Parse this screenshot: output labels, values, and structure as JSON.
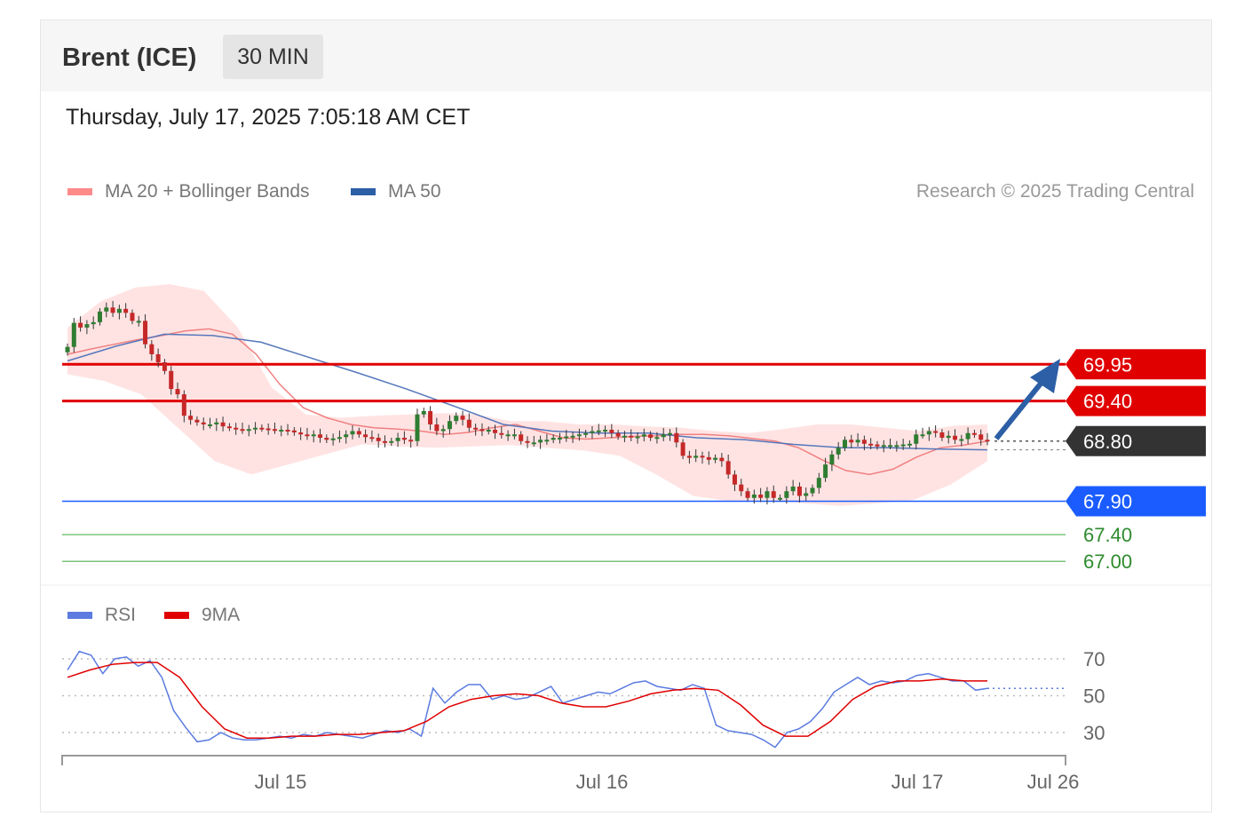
{
  "header": {
    "instrument": "Brent (ICE)",
    "timeframe": "30 MIN",
    "timestamp": "Thursday, July 17, 2025 7:05:18 AM CET"
  },
  "legend": {
    "ma20_label": "MA 20 + Bollinger Bands",
    "ma50_label": "MA 50",
    "credit": "Research © 2025 Trading Central",
    "rsi_label": "RSI",
    "rsi_ma_label": "9MA"
  },
  "colors": {
    "bull_candle": "#2e7d32",
    "bear_candle": "#c62828",
    "bollinger_fill": "#ffdede",
    "ma20": "#f08080",
    "ma50": "#5577bb",
    "resistance": "#e00000",
    "support_primary": "#1a5cff",
    "support_secondary": "#7bc47b",
    "current_price": "#333333",
    "rsi": "#5b7be0",
    "rsi_ma": "#e00000",
    "arrow": "#2c5fa5"
  },
  "chart_data": [
    {
      "type": "candlestick",
      "title": "Brent (ICE) 30 MIN",
      "ylim": [
        66.9,
        71.1
      ],
      "x_ticks": [
        "Jul 15",
        "Jul 16",
        "Jul 17",
        "Jul 26"
      ],
      "current_price": "68.80",
      "projection": "upward toward 69.95",
      "levels": [
        {
          "value": "69.95",
          "type": "resistance"
        },
        {
          "value": "69.40",
          "type": "resistance"
        },
        {
          "value": "68.80",
          "type": "current"
        },
        {
          "value": "67.90",
          "type": "support"
        },
        {
          "value": "67.40",
          "type": "support"
        },
        {
          "value": "67.00",
          "type": "support"
        }
      ],
      "close_series": [
        70.21,
        70.57,
        70.5,
        70.55,
        70.58,
        70.74,
        70.8,
        70.72,
        70.78,
        70.72,
        70.6,
        70.6,
        70.25,
        70.1,
        69.98,
        69.85,
        69.58,
        69.5,
        69.18,
        69.12,
        69.08,
        69.05,
        69.05,
        69.08,
        69.02,
        69.0,
        68.98,
        68.97,
        68.98,
        69.0,
        68.99,
        68.98,
        68.97,
        68.97,
        68.96,
        68.93,
        68.9,
        68.88,
        68.9,
        68.85,
        68.82,
        68.84,
        68.86,
        68.9,
        68.95,
        68.9,
        68.86,
        68.85,
        68.8,
        68.78,
        68.8,
        68.85,
        68.82,
        68.8,
        69.2,
        69.25,
        69.05,
        68.95,
        68.98,
        69.1,
        69.18,
        69.12,
        69.0,
        68.98,
        68.95,
        68.97,
        68.92,
        68.9,
        68.9,
        68.9,
        68.8,
        68.78,
        68.78,
        68.82,
        68.82,
        68.85,
        68.85,
        68.87,
        68.88,
        68.9,
        68.92,
        68.95,
        68.96,
        68.97,
        68.92,
        68.87,
        68.88,
        68.86,
        68.87,
        68.9,
        68.85,
        68.86,
        68.9,
        68.92,
        68.78,
        68.58,
        68.55,
        68.58,
        68.56,
        68.52,
        68.55,
        68.5,
        68.3,
        68.15,
        68.05,
        67.95,
        68.0,
        67.95,
        68.05,
        67.95,
        67.95,
        68.05,
        68.12,
        67.98,
        68.02,
        68.1,
        68.25,
        68.45,
        68.6,
        68.7,
        68.82,
        68.78,
        68.82,
        68.76,
        68.75,
        68.72,
        68.74,
        68.74,
        68.74,
        68.75,
        68.76,
        68.9,
        68.9,
        68.95,
        68.93,
        68.85,
        68.88,
        68.82,
        68.83,
        68.92,
        68.9,
        68.82,
        68.8
      ],
      "ma20_series": [
        70.1,
        70.18,
        70.25,
        70.32,
        70.38,
        70.45,
        70.48,
        70.4,
        70.1,
        69.65,
        69.3,
        69.15,
        69.05,
        69.0,
        68.98,
        68.95,
        68.9,
        68.93,
        69.0,
        69.05,
        68.95,
        68.85,
        68.83,
        68.85,
        68.87,
        68.88,
        68.9,
        68.9,
        68.88,
        68.84,
        68.8,
        68.7,
        68.52,
        68.36,
        68.3,
        68.38,
        68.56,
        68.7,
        68.74,
        68.8
      ],
      "ma50_series": [
        70.0,
        70.22,
        70.4,
        70.38,
        70.28,
        70.05,
        69.82,
        69.58,
        69.32,
        69.05,
        68.95,
        68.92,
        68.92,
        68.85,
        68.82,
        68.75,
        68.7,
        68.7,
        68.68,
        68.67
      ],
      "bollinger_upper": [
        70.5,
        70.9,
        71.1,
        71.15,
        71.05,
        70.5,
        69.6,
        69.2,
        69.15,
        69.18,
        69.2,
        69.22,
        69.2,
        69.1,
        69.1,
        69.05,
        69.05,
        69.02,
        69.0,
        68.95,
        68.92,
        68.98,
        69.05,
        69.05,
        69.0,
        68.95,
        69.03,
        69.05
      ],
      "bollinger_lower": [
        69.8,
        69.7,
        69.5,
        69.0,
        68.5,
        68.3,
        68.45,
        68.6,
        68.75,
        68.72,
        68.7,
        68.72,
        68.74,
        68.7,
        68.66,
        68.58,
        68.3,
        67.98,
        67.9,
        67.92,
        67.87,
        67.83,
        67.87,
        67.92,
        68.15,
        68.5
      ]
    },
    {
      "type": "line",
      "title": "RSI",
      "ylim": [
        15,
        85
      ],
      "y_ticks": [
        "70",
        "50",
        "30"
      ],
      "series": [
        {
          "name": "RSI",
          "values": [
            64,
            74,
            72,
            62,
            70,
            71,
            66,
            69,
            60,
            42,
            33,
            25,
            26,
            30,
            27,
            26,
            26,
            27,
            28,
            27,
            29,
            28,
            30,
            29,
            28,
            27,
            29,
            31,
            30,
            32,
            28,
            54,
            46,
            52,
            56,
            56,
            48,
            50,
            48,
            49,
            52,
            55,
            46,
            48,
            50,
            52,
            51,
            54,
            57,
            58,
            55,
            54,
            53,
            56,
            54,
            34,
            31,
            30,
            29,
            26,
            22,
            30,
            32,
            36,
            43,
            52,
            56,
            60,
            56,
            58,
            57,
            58,
            61,
            62,
            60,
            58,
            58,
            53,
            54
          ]
        },
        {
          "name": "9MA",
          "values": [
            60,
            64,
            67,
            68,
            68,
            60,
            44,
            32,
            27,
            27,
            28,
            28,
            29,
            29,
            30,
            31,
            36,
            44,
            48,
            50,
            51,
            50,
            46,
            44,
            44,
            47,
            51,
            53,
            54,
            53,
            45,
            34,
            28,
            28,
            36,
            48,
            55,
            58,
            58,
            59,
            58,
            58
          ]
        }
      ]
    }
  ]
}
